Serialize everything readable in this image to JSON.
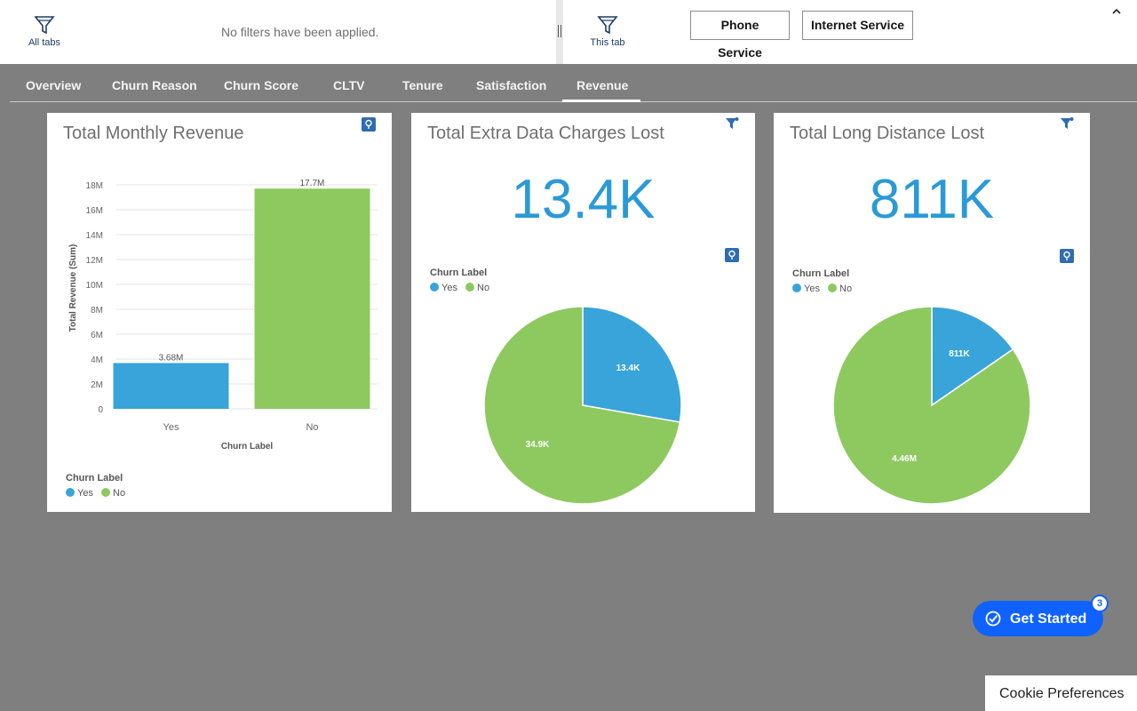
{
  "filter_bar": {
    "all_tabs_label": "All tabs",
    "no_filters_text": "No filters have been applied.",
    "this_tab_label": "This tab",
    "chips": [
      "Phone Service",
      "Internet Service"
    ]
  },
  "tabs": [
    {
      "label": "Overview"
    },
    {
      "label": "Churn Reason"
    },
    {
      "label": "Churn Score"
    },
    {
      "label": "CLTV"
    },
    {
      "label": "Tenure"
    },
    {
      "label": "Satisfaction"
    },
    {
      "label": "Revenue",
      "active": true
    }
  ],
  "cards": {
    "monthly": {
      "title": "Total Monthly Revenue",
      "legend_title": "Churn Label",
      "legend": [
        "Yes",
        "No"
      ]
    },
    "extra_data": {
      "title": "Total Extra Data Charges Lost",
      "big_value": "13.4K",
      "legend_title": "Churn Label",
      "legend": [
        "Yes",
        "No"
      ]
    },
    "long_distance": {
      "title": "Total Long Distance Lost",
      "big_value": "811K",
      "legend_title": "Churn Label",
      "legend": [
        "Yes",
        "No"
      ]
    }
  },
  "colors": {
    "yes": "#38a4da",
    "no": "#8ec95f",
    "accent": "#2a9ad7",
    "background": "#7f7f7f",
    "primary_button": "#0f62fe"
  },
  "icons": {
    "all_tabs": "filter-icon",
    "this_tab": "filter-icon",
    "collapse": "chevron-up-icon",
    "monthly_card": "pin-icon",
    "extra_data_card": "filter-dot-icon",
    "extra_data_pie": "pin-icon",
    "long_distance_card": "filter-dot-icon",
    "long_distance_pie": "pin-icon",
    "get_started": "checkmark-circle-icon"
  },
  "chart_data": [
    {
      "type": "bar",
      "title": "Total Monthly Revenue",
      "categories": [
        "Yes",
        "No"
      ],
      "values": [
        3.68,
        17.7
      ],
      "value_labels": [
        "3.68M",
        "17.7M"
      ],
      "y_ticks": [
        "0",
        "2M",
        "4M",
        "6M",
        "8M",
        "10M",
        "12M",
        "14M",
        "16M",
        "18M"
      ],
      "ylim": [
        0,
        18
      ],
      "xlabel": "Churn Label",
      "ylabel": "Total Revenue (Sum)",
      "grid": true,
      "legend": "bottom-left"
    },
    {
      "type": "pie",
      "title": "Total Extra Data Charges Lost",
      "labels": [
        "Yes",
        "No"
      ],
      "values": [
        13.4,
        34.9
      ],
      "value_labels": [
        "13.4K",
        "34.9K"
      ],
      "legend": "top-left"
    },
    {
      "type": "pie",
      "title": "Total Long Distance Lost",
      "labels": [
        "Yes",
        "No"
      ],
      "values": [
        811,
        4460
      ],
      "value_labels": [
        "811K",
        "4.46M"
      ],
      "legend": "top-left"
    }
  ],
  "floating": {
    "get_started_label": "Get Started",
    "get_started_badge": "3",
    "cookie_label": "Cookie Preferences"
  }
}
